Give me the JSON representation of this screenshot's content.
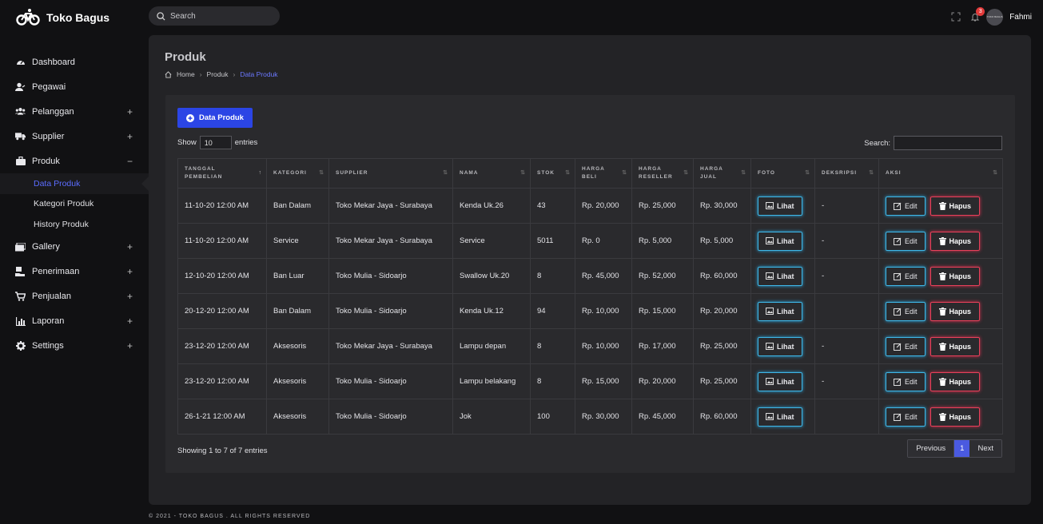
{
  "brand": {
    "name": "Toko Bagus"
  },
  "search": {
    "placeholder": "Search"
  },
  "topbar": {
    "notif_count": "3",
    "avatar_text": "TOKO BAGUS",
    "user_name": "Fahmi"
  },
  "sidebar": {
    "items": [
      {
        "label": "Dashboard",
        "icon": "dashboard-icon",
        "toggle": ""
      },
      {
        "label": "Pegawai",
        "icon": "user-icon",
        "toggle": ""
      },
      {
        "label": "Pelanggan",
        "icon": "users-icon",
        "toggle": "+"
      },
      {
        "label": "Supplier",
        "icon": "truck-icon",
        "toggle": "+"
      },
      {
        "label": "Produk",
        "icon": "briefcase-icon",
        "toggle": "−"
      }
    ],
    "subitems": [
      "Data Produk",
      "Kategori Produk",
      "History Produk"
    ],
    "items2": [
      {
        "label": "Gallery",
        "icon": "image-icon",
        "toggle": "+"
      },
      {
        "label": "Penerimaan",
        "icon": "receive-icon",
        "toggle": "+"
      },
      {
        "label": "Penjualan",
        "icon": "cart-icon",
        "toggle": "+"
      },
      {
        "label": "Laporan",
        "icon": "chart-icon",
        "toggle": "+"
      },
      {
        "label": "Settings",
        "icon": "gear-icon",
        "toggle": "+"
      }
    ]
  },
  "page": {
    "title": "Produk",
    "breadcrumb": [
      "Home",
      "Produk",
      "Data Produk"
    ]
  },
  "toolbar": {
    "add_label": "Data Produk",
    "show_label": "Show",
    "entries_value": "10",
    "entries_label": "entries",
    "search_label": "Search:"
  },
  "table": {
    "headers": [
      [
        "TANGGAL",
        "PEMBELIAN"
      ],
      [
        "KATEGORI",
        ""
      ],
      [
        "SUPPLIER",
        ""
      ],
      [
        "NAMA",
        ""
      ],
      [
        "STOK",
        ""
      ],
      [
        "HARGA",
        "BELI"
      ],
      [
        "HARGA",
        "RESELLER"
      ],
      [
        "HARGA",
        "JUAL"
      ],
      [
        "FOTO",
        ""
      ],
      [
        "DEKSRIPSI",
        ""
      ],
      [
        "AKSI",
        ""
      ]
    ],
    "view_label": "Lihat",
    "edit_label": "Edit",
    "delete_label": "Hapus",
    "rows": [
      [
        "11-10-20 12:00 AM",
        "Ban Dalam",
        "Toko Mekar Jaya - Surabaya",
        "Kenda Uk.26",
        "43",
        "Rp. 20,000",
        "Rp. 25,000",
        "Rp. 30,000",
        "-"
      ],
      [
        "11-10-20 12:00 AM",
        "Service",
        "Toko Mekar Jaya - Surabaya",
        "Service",
        "5011",
        "Rp. 0",
        "Rp. 5,000",
        "Rp. 5,000",
        "-"
      ],
      [
        "12-10-20 12:00 AM",
        "Ban Luar",
        "Toko Mulia - Sidoarjo",
        "Swallow Uk.20",
        "8",
        "Rp. 45,000",
        "Rp. 52,000",
        "Rp. 60,000",
        "-"
      ],
      [
        "20-12-20 12:00 AM",
        "Ban Dalam",
        "Toko Mulia - Sidoarjo",
        "Kenda Uk.12",
        "94",
        "Rp. 10,000",
        "Rp. 15,000",
        "Rp. 20,000",
        ""
      ],
      [
        "23-12-20 12:00 AM",
        "Aksesoris",
        "Toko Mekar Jaya - Surabaya",
        "Lampu depan",
        "8",
        "Rp. 10,000",
        "Rp. 17,000",
        "Rp. 25,000",
        "-"
      ],
      [
        "23-12-20 12:00 AM",
        "Aksesoris",
        "Toko Mulia - Sidoarjo",
        "Lampu belakang",
        "8",
        "Rp. 15,000",
        "Rp. 20,000",
        "Rp. 25,000",
        "-"
      ],
      [
        "26-1-21 12:00 AM",
        "Aksesoris",
        "Toko Mulia - Sidoarjo",
        "Jok",
        "100",
        "Rp. 30,000",
        "Rp. 45,000",
        "Rp. 60,000",
        ""
      ]
    ]
  },
  "pagination": {
    "info": "Showing 1 to 7 of 7 entries",
    "prev": "Previous",
    "current": "1",
    "next": "Next"
  },
  "footer": {
    "text": "© 2021 - TOKO BAGUS . ALL RIGHTS RESERVED"
  },
  "colors": {
    "accent": "#2b45e5",
    "active_link": "#5b6cff",
    "edit_border": "#3fb8e8",
    "delete_border": "#e8405a"
  }
}
